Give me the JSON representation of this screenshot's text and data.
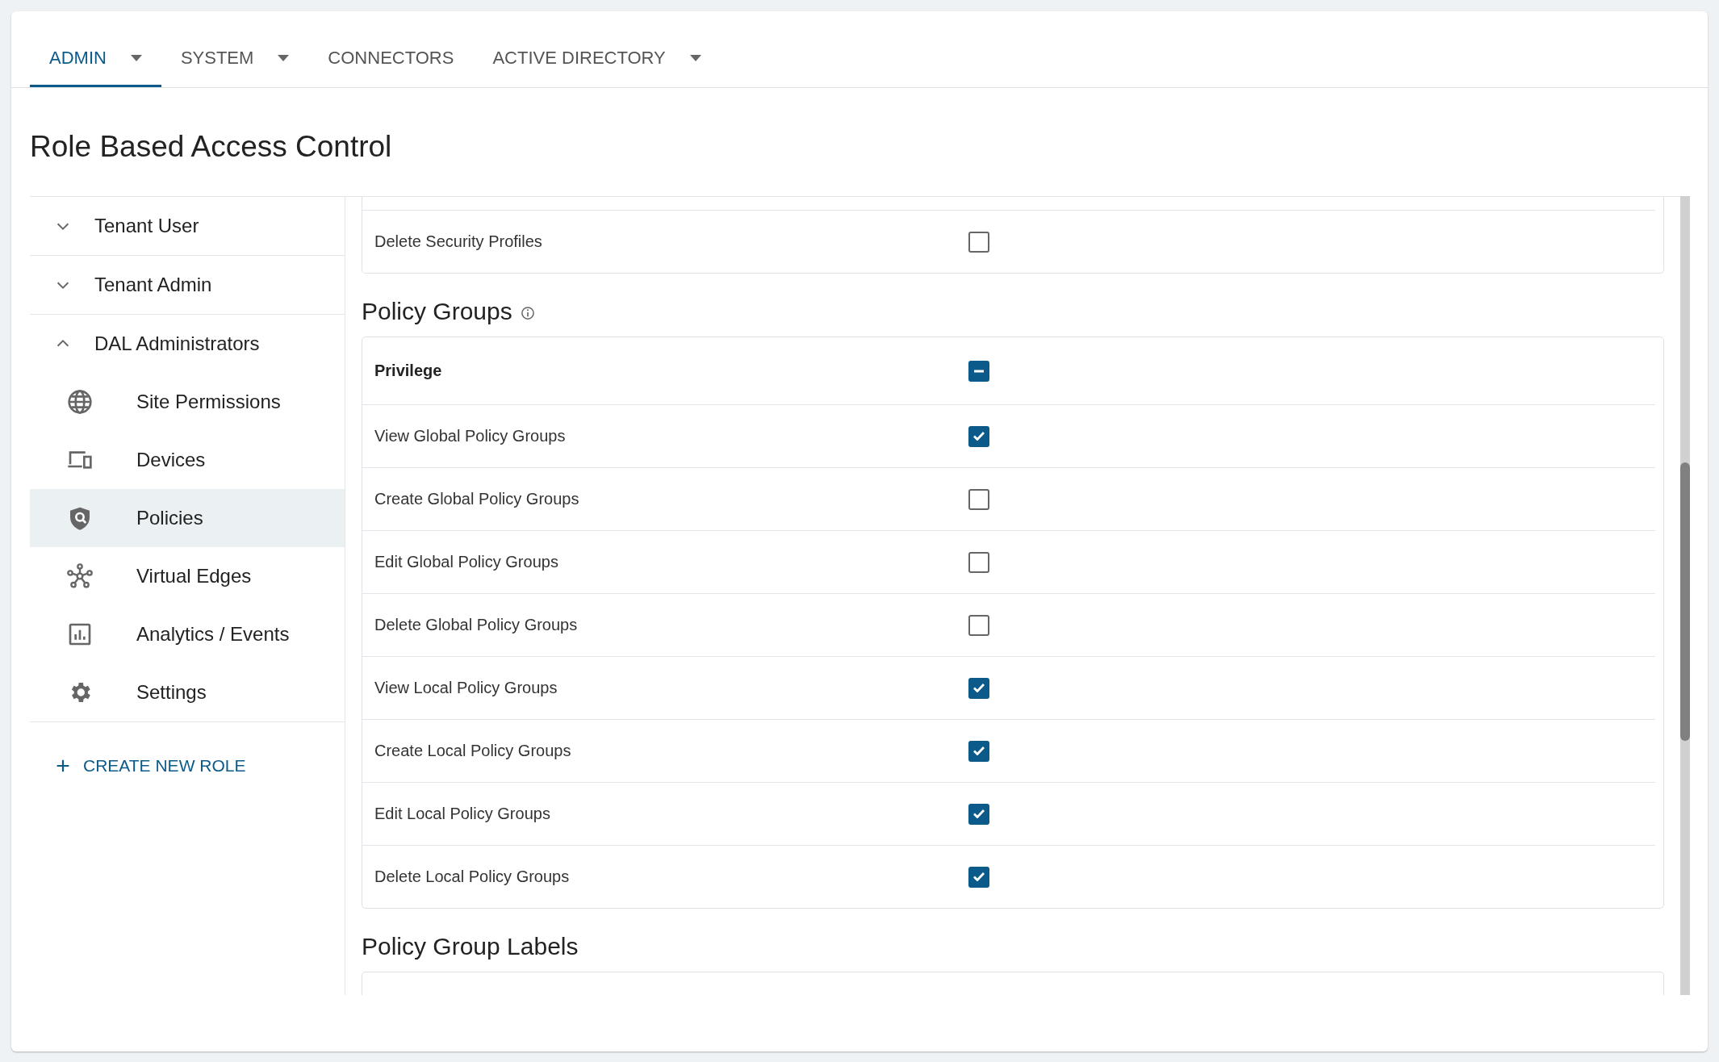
{
  "tabs": [
    {
      "label": "ADMIN",
      "selected": true,
      "has_menu": true
    },
    {
      "label": "SYSTEM",
      "selected": false,
      "has_menu": true
    },
    {
      "label": "CONNECTORS",
      "selected": false,
      "has_menu": false
    },
    {
      "label": "ACTIVE DIRECTORY",
      "selected": false,
      "has_menu": true
    }
  ],
  "title": "Role Based Access Control",
  "roles": [
    {
      "name": "Tenant User",
      "expanded": false
    },
    {
      "name": "Tenant Admin",
      "expanded": false
    },
    {
      "name": "DAL Administrators",
      "expanded": true,
      "children": [
        {
          "label": "Site Permissions",
          "selected": false
        },
        {
          "label": "Devices",
          "selected": false
        },
        {
          "label": "Policies",
          "selected": true
        },
        {
          "label": "Virtual Edges",
          "selected": false
        },
        {
          "label": "Analytics / Events",
          "selected": false
        },
        {
          "label": "Settings",
          "selected": false
        }
      ]
    }
  ],
  "create_role": "CREATE NEW ROLE",
  "sections": [
    {
      "rows": [
        {
          "kind": "permission",
          "label": "Delete Security Profiles",
          "checked": false
        }
      ]
    },
    {
      "title": "Policy Groups",
      "info": true,
      "rows": [
        {
          "kind": "privilege",
          "label": "Privilege",
          "indeterminate": true
        },
        {
          "kind": "permission",
          "label": "View Global Policy Groups",
          "checked": true
        },
        {
          "kind": "permission",
          "label": "Create Global Policy Groups",
          "checked": false
        },
        {
          "kind": "permission",
          "label": "Edit Global Policy Groups",
          "checked": false
        },
        {
          "kind": "permission",
          "label": "Delete Global Policy Groups",
          "checked": false
        },
        {
          "kind": "permission",
          "label": "View Local Policy Groups",
          "checked": true
        },
        {
          "kind": "permission",
          "label": "Create Local Policy Groups",
          "checked": true
        },
        {
          "kind": "permission",
          "label": "Edit Local Policy Groups",
          "checked": true
        },
        {
          "kind": "permission",
          "label": "Delete Local Policy Groups",
          "checked": true
        }
      ]
    },
    {
      "title": "Policy Group Labels"
    }
  ]
}
